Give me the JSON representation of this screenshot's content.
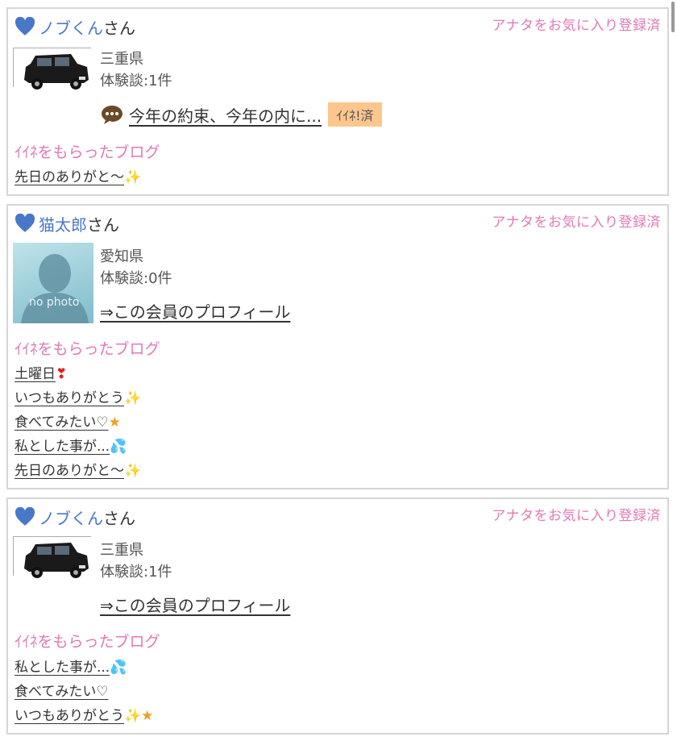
{
  "fav_label": "アナタをお気に入り登録済",
  "san_suffix": "さん",
  "blog_section_title": "ｲｲﾈをもらったブログ",
  "cards": [
    {
      "username": "ノブくん",
      "location": "三重県",
      "reviews": "体験談:1件",
      "comment": "今年の約束、今年の内に...",
      "iine_badge": "ｲｲﾈ!済",
      "blogs": [
        "先日のありがと〜"
      ]
    },
    {
      "username": "猫太郎",
      "photo_text": "no photo",
      "location": "愛知県",
      "reviews": "体験談:0件",
      "profile_link": "⇒この会員のプロフィール",
      "blogs": [
        "土曜日",
        "いつもありがとう",
        "食べてみたい♡",
        "私とした事が...",
        "先日のありがと〜"
      ]
    },
    {
      "username": "ノブくん",
      "location": "三重県",
      "reviews": "体験談:1件",
      "profile_link": "⇒この会員のプロフィール",
      "blogs": [
        "私とした事が...",
        "食べてみたい♡",
        "いつもありがとう"
      ]
    }
  ],
  "colors": {
    "accent_pink": "#e07ab6",
    "link_blue": "#4a78c8",
    "badge_orange": "#fcc68d"
  }
}
